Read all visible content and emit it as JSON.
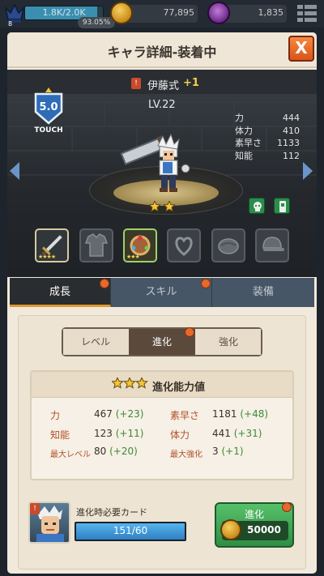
{
  "top_bar": {
    "rank_number": "8",
    "xp_text": "1.8K/2.0K",
    "xp_fraction": 0.9305,
    "xp_percent": "93.05%",
    "gold": "77,895",
    "gems": "1,835"
  },
  "dialog": {
    "title": "キャラ詳細-装着中",
    "close_label": "X"
  },
  "hero": {
    "name_badge": "!",
    "name": "伊藤式",
    "plus": "+1",
    "level": "LV.22",
    "rank_value": "5.0",
    "rank_label": "TOUCH",
    "stars": 2,
    "stats": [
      {
        "label": "力",
        "value": "444"
      },
      {
        "label": "体力",
        "value": "410"
      },
      {
        "label": "素早さ",
        "value": "1133"
      },
      {
        "label": "知能",
        "value": "112"
      }
    ]
  },
  "equipment": [
    {
      "name": "weapon",
      "equipped": true,
      "stars": "★★★★"
    },
    {
      "name": "armor",
      "equipped": false,
      "stars": ""
    },
    {
      "name": "accessory",
      "equipped": true,
      "stars": "★★★"
    },
    {
      "name": "amulet",
      "equipped": false,
      "stars": ""
    },
    {
      "name": "boots",
      "equipped": false,
      "stars": ""
    },
    {
      "name": "helmet",
      "equipped": false,
      "stars": ""
    }
  ],
  "tabs": [
    {
      "label": "成長",
      "active": true,
      "dot": true
    },
    {
      "label": "スキル",
      "active": false,
      "dot": true
    },
    {
      "label": "装備",
      "active": false,
      "dot": false
    }
  ],
  "subtabs": [
    {
      "label": "レベル",
      "active": false
    },
    {
      "label": "進化",
      "active": true,
      "dot": true
    },
    {
      "label": "強化",
      "active": false
    }
  ],
  "evolution": {
    "title": "進化能力値",
    "stars": 3,
    "stats": [
      {
        "label": "力",
        "value": "467",
        "delta": "(+23)"
      },
      {
        "label": "知能",
        "value": "123",
        "delta": "(+11)"
      },
      {
        "label": "最大レベル",
        "value": "80",
        "delta": "(+20)"
      },
      {
        "label": "素早さ",
        "value": "1181",
        "delta": "(+48)"
      },
      {
        "label": "体力",
        "value": "441",
        "delta": "(+31)"
      },
      {
        "label": "最大強化",
        "value": "3",
        "delta": "(+1)"
      }
    ]
  },
  "requirement": {
    "label": "進化時必要カード",
    "progress_text": "151/60",
    "progress_fraction": 1.0,
    "portrait_badge": "!"
  },
  "evolve_button": {
    "label": "進化",
    "cost": "50000"
  },
  "colors": {
    "accent_orange": "#e8692c",
    "tab_active_underline": "#e09a2e",
    "stat_key": "#b2502a",
    "stat_delta": "#3e8a36",
    "evolve_green": "#2f8e44"
  }
}
